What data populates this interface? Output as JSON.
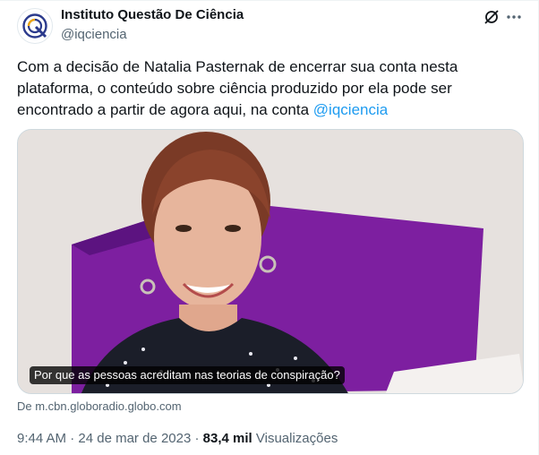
{
  "author": {
    "display_name": "Instituto Questão De Ciência",
    "handle": "@iqciencia"
  },
  "tweet": {
    "text_before_mention": "Com a decisão de Natalia Pasternak de encerrar sua conta nesta plataforma, o conteúdo sobre ciência produzido por ela pode ser encontrado a partir de agora aqui, na conta ",
    "mention": "@iqciencia"
  },
  "card": {
    "caption": "Por que as pessoas acreditam nas teorias de conspiração?",
    "source": "De m.cbn.globoradio.globo.com"
  },
  "meta": {
    "time": "9:44 AM",
    "separator": "·",
    "date": "24 de mar de 2023",
    "views_count": "83,4 mil",
    "views_label": "Visualizações"
  },
  "icons": {
    "avatar": "iqc-logo-icon",
    "grok": "grok-icon",
    "more": "more-horizontal-icon"
  },
  "colors": {
    "link": "#1d9bf0",
    "secondary_text": "#536471",
    "purple_accent": "#7d1fa0",
    "background": "#ffffff"
  }
}
